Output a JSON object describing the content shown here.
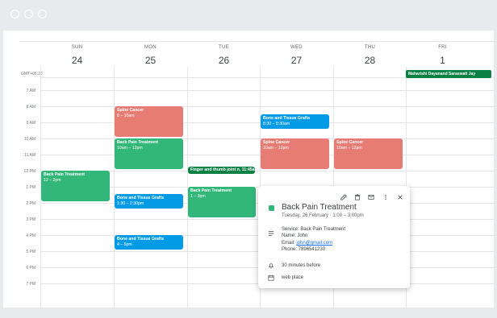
{
  "timezone": "GMT+05:30",
  "days": [
    {
      "dow": "SUN",
      "num": "24"
    },
    {
      "dow": "MON",
      "num": "25"
    },
    {
      "dow": "TUE",
      "num": "26"
    },
    {
      "dow": "WED",
      "num": "27"
    },
    {
      "dow": "THU",
      "num": "28"
    },
    {
      "dow": "FRI",
      "num": "1"
    }
  ],
  "hours": [
    "7 AM",
    "8 AM",
    "9 AM",
    "10 AM",
    "11 AM",
    "12 PM",
    "1 PM",
    "2 PM",
    "3 PM",
    "4 PM",
    "5 PM",
    "6 PM",
    "7 PM"
  ],
  "allday": {
    "label": "Maharishi Dayanand Saraswati Jay",
    "color": "#0b8043"
  },
  "events": [
    {
      "title": "Spine Cancer",
      "time": "8 – 10am",
      "color": "#e67c73"
    },
    {
      "title": "Back Pain Treatment",
      "time": "10am – 12pm",
      "color": "#33b679"
    },
    {
      "title": "Back Pain Treatment",
      "time": "12 – 2pm",
      "color": "#33b679"
    },
    {
      "title": "Bone and Tissue Grafts",
      "time": "1:30 – 2:30pm",
      "color": "#039be5"
    },
    {
      "title": "Bone and Tissue Grafts",
      "time": "4 – 5pm",
      "color": "#039be5"
    },
    {
      "title": "Finger and thumb joint n, 11:45am",
      "time": "",
      "color": "#0b8043"
    },
    {
      "title": "Back Pain Treatment",
      "time": "1 – 3pm",
      "color": "#33b679"
    },
    {
      "title": "Bone and Tissue Grafts",
      "time": "8:30 – 9:30am",
      "color": "#039be5"
    },
    {
      "title": "Spine Cancer",
      "time": "10am – 12pm",
      "color": "#e67c73"
    },
    {
      "title": "Spine Cancer",
      "time": "10am – 12pm",
      "color": "#e67c73"
    }
  ],
  "popup": {
    "title": "Back Pain Treatment",
    "when": "Tuesday, 26 February  ·  1:00 – 3:00pm",
    "service": "Service: Back Pain Treatment",
    "name": "Name: John",
    "email_label": "Email: ",
    "email": "john@gmail.com",
    "phone": "Phone: 7896541230",
    "reminder": "30 minutes before",
    "calendar": "web place",
    "color": "#33b679"
  }
}
